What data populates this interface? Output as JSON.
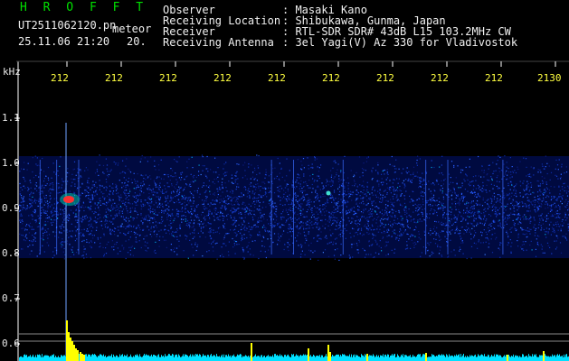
{
  "header": {
    "logo": "H R O F F T",
    "filename": "UT2511062120.pn",
    "meteor_label": "meteor",
    "datetime": "25.11.06 21:20",
    "count": "20.",
    "fields": [
      {
        "label": "Observer",
        "value": ": Masaki Kano"
      },
      {
        "label": "Receiving Location",
        "value": ": Shibukawa, Gunma, Japan"
      },
      {
        "label": "Receiver",
        "value": ": RTL-SDR SDR# 43dB L15 103.2MHz CW"
      },
      {
        "label": "Receiving Antenna",
        "value": ": 3el Yagi(V) Az 330 for Vladivostok"
      }
    ]
  },
  "y_axis": {
    "unit": "kHz",
    "ticks": [
      {
        "label": "1.1",
        "value": 1.1
      },
      {
        "label": "1.0",
        "value": 1.0
      },
      {
        "label": "0.9",
        "value": 0.9
      },
      {
        "label": "0.8",
        "value": 0.8
      },
      {
        "label": "0.7",
        "value": 0.7
      },
      {
        "label": "0.6",
        "value": 0.6
      }
    ]
  },
  "x_axis": {
    "tick_labels": [
      "212",
      "212",
      "212",
      "212",
      "212",
      "212",
      "212",
      "212",
      "212",
      "2130"
    ]
  },
  "colors": {
    "background": "#000000",
    "noise_band": "#0a2aa0",
    "meteor_head": "#ff3030",
    "level_bar": "#00e0ff",
    "level_spike": "#ffff00",
    "header_logo": "#00e000",
    "tick_label": "#ffff40"
  },
  "spectrogram": {
    "band_top_khz": 1.0,
    "band_bottom_khz": 0.79,
    "meteor_center_khz": 0.92,
    "vertical_traces_minute_fraction": [
      0.04,
      0.07,
      0.11,
      0.46,
      0.5,
      0.59,
      0.74,
      0.78,
      0.88
    ]
  }
}
